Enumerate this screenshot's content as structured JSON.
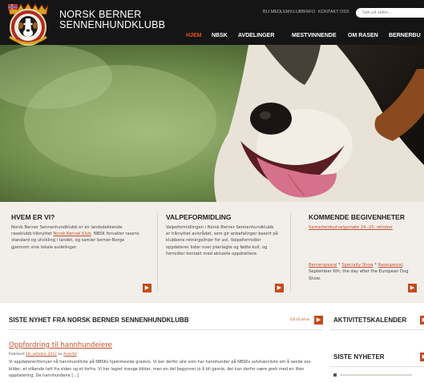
{
  "header": {
    "brand_line1": "NORSK BERNER",
    "brand_line2": "SENNENHUNDKLUBB",
    "util_links": [
      "BLI MEDLEM",
      "KLUBBINFO",
      "KONTAKT OSS"
    ],
    "search_placeholder": "Søk på siden...",
    "nav": [
      "HJEM",
      "NBSK",
      "AVDELINGER",
      "MESTVINNENDE",
      "OM RASEN",
      "BERNERBU"
    ],
    "active_nav": "HJEM"
  },
  "info": {
    "col1": {
      "title": "HVEM ER VI?",
      "text_a": "Norsk Berner Sennenhundklubb er en landsdekkende raseklubb tilknyttet ",
      "link": "Norsk Kennel Klub",
      "text_b": ". NBSK forvalter rasens standard og utvikling i landet, og samler berner-Norge gjennom sine lokale avdelinger."
    },
    "col2": {
      "title": "VALPEFORMIDLING",
      "text": "Valpeformidlingen i Norsk Berner Sennenhundklubb er tilknyttet avlsrådet, som gir anbefalinger basert på klubbens retningslinjer for avl. Valpeformidler oppdaterer lister over planlagte og fødte kull, og formidler kontakt med aktuelle oppdrettere."
    },
    "col3": {
      "title": "KOMMENDE BEGIVENHETER",
      "event_link": "Samarbeidsutvalgsmøte 24.-25. oktober",
      "link1": "Bernerspesial",
      "sep1": " * ",
      "link2": "Specialty Show",
      "sep2": " * ",
      "link3": "Rasespesial",
      "tail": ", September 6th, the day after the European Dog Show."
    },
    "arrow": "▶"
  },
  "news": {
    "section_title": "SISTE NYHET FRA NORSK BERNER SENNENHUNDKLUBB",
    "archive_link": "Gå til arkiv",
    "article_title": "Oppfordring til hannhundeiere",
    "meta_prefix": "Publisert ",
    "meta_date": "18. oktober 2012",
    "meta_mid": " av ",
    "meta_author": "Avlsråd",
    "excerpt": "Vi oppdaterer/fornyer nå hannhundliste på NBSKs hjemmeside gradvis. Vi ber derfor alle som har hannhunder på NBSKs avlshannliste om å sende oss bilder, et stående tatt fra siden og et forfra. Vi har lagret mange bilder, men en del begynner jo å bli gamle, det kan derfor være greit med en liten oppdatering. De hannhundene […]"
  },
  "sidebar": {
    "calendar_title": "AKTIVITETSKALENDER",
    "news_title": "SISTE NYHETER"
  },
  "colors": {
    "accent": "#c0502a",
    "header_bg": "#151515",
    "info_bg": "#f2efeb"
  },
  "icons": [
    "logo-emblem",
    "arrow-right-icon"
  ]
}
